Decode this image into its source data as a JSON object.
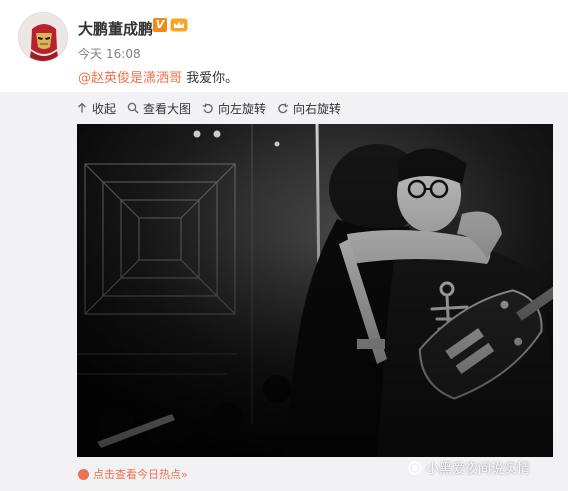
{
  "post": {
    "username": "大鹏董成鹏",
    "verified_mark": "V",
    "time": {
      "day": "今天",
      "clock": "16:08"
    },
    "mention": "@赵英俊是潇洒哥",
    "text": "我爱你。"
  },
  "toolbar": {
    "items": [
      {
        "label": "收起",
        "icon": "collapse-up-icon"
      },
      {
        "label": "查看大图",
        "icon": "magnifier-icon"
      },
      {
        "label": "向左旋转",
        "icon": "rotate-left-icon"
      },
      {
        "label": "向右旋转",
        "icon": "rotate-right-icon"
      }
    ]
  },
  "hot_link": {
    "label": "点击查看今日热点»",
    "icon": "hot-flame-icon"
  },
  "watermark": {
    "text": "小黑爱夜间说实情",
    "icon": "watermark-logo-icon"
  },
  "colors": {
    "accent_orange": "#eb7350",
    "verified_orange": "#f08a1c",
    "media_background": "#f2f2f5"
  }
}
